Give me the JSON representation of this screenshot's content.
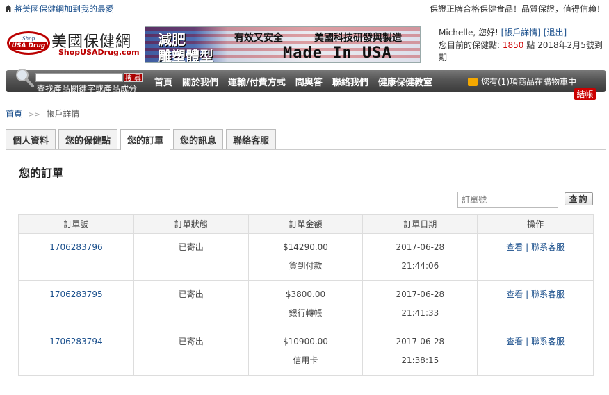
{
  "top": {
    "favorite_link": "將美國保健網加到我的最愛",
    "slogan": "保證正牌合格保健食品！品質保證，值得信賴！"
  },
  "logo": {
    "badge_top": "Shop",
    "badge_bottom": "USA Drug",
    "name": "美國保健網",
    "url": "ShopUSADrug.com"
  },
  "banner": {
    "line1": "減肥",
    "line2": "雕塑體型",
    "tag1": "有效又安全",
    "tag2": "美國科技研發與製造",
    "made": "Made In USA"
  },
  "user": {
    "greeting": "Michelle, 您好!",
    "account_link": "[帳戶詳情]",
    "logout_link": "[退出]",
    "points_prefix": "您目前的保健點:",
    "points_value": "1850",
    "points_suffix": "點  2018年2月5號到期"
  },
  "nav": {
    "search_placeholder": "",
    "search_button": "搜 尋",
    "search_hint": "查找產品關鍵字或產品成分",
    "items": [
      "首頁",
      "關於我們",
      "運輸/付費方式",
      "問與答",
      "聯絡我們",
      "健康保健教室"
    ],
    "cart_text": "您有(1)項商品在購物車中",
    "checkout": "結帳"
  },
  "breadcrumb": {
    "home": "首頁",
    "sep": ">>",
    "current": "帳戶詳情"
  },
  "tabs": [
    "個人資料",
    "您的保健點",
    "您的訂單",
    "您的訊息",
    "聯絡客服"
  ],
  "section_title": "您的訂單",
  "order_search": {
    "placeholder": "訂單號",
    "button": "查詢"
  },
  "table": {
    "headers": [
      "訂單號",
      "訂單狀態",
      "訂單金額",
      "訂單日期",
      "操作"
    ],
    "rows": [
      {
        "id": "1706283796",
        "status": "已寄出",
        "amount": "$14290.00",
        "payment": "貨到付款",
        "date": "2017-06-28",
        "time": "21:44:06",
        "view": "查看",
        "sep": "|",
        "contact": "聯系客服"
      },
      {
        "id": "1706283795",
        "status": "已寄出",
        "amount": "$3800.00",
        "payment": "銀行轉帳",
        "date": "2017-06-28",
        "time": "21:41:33",
        "view": "查看",
        "sep": "|",
        "contact": "聯系客服"
      },
      {
        "id": "1706283794",
        "status": "已寄出",
        "amount": "$10900.00",
        "payment": "信用卡",
        "date": "2017-06-28",
        "time": "21:38:15",
        "view": "查看",
        "sep": "|",
        "contact": "聯系客服"
      }
    ]
  }
}
